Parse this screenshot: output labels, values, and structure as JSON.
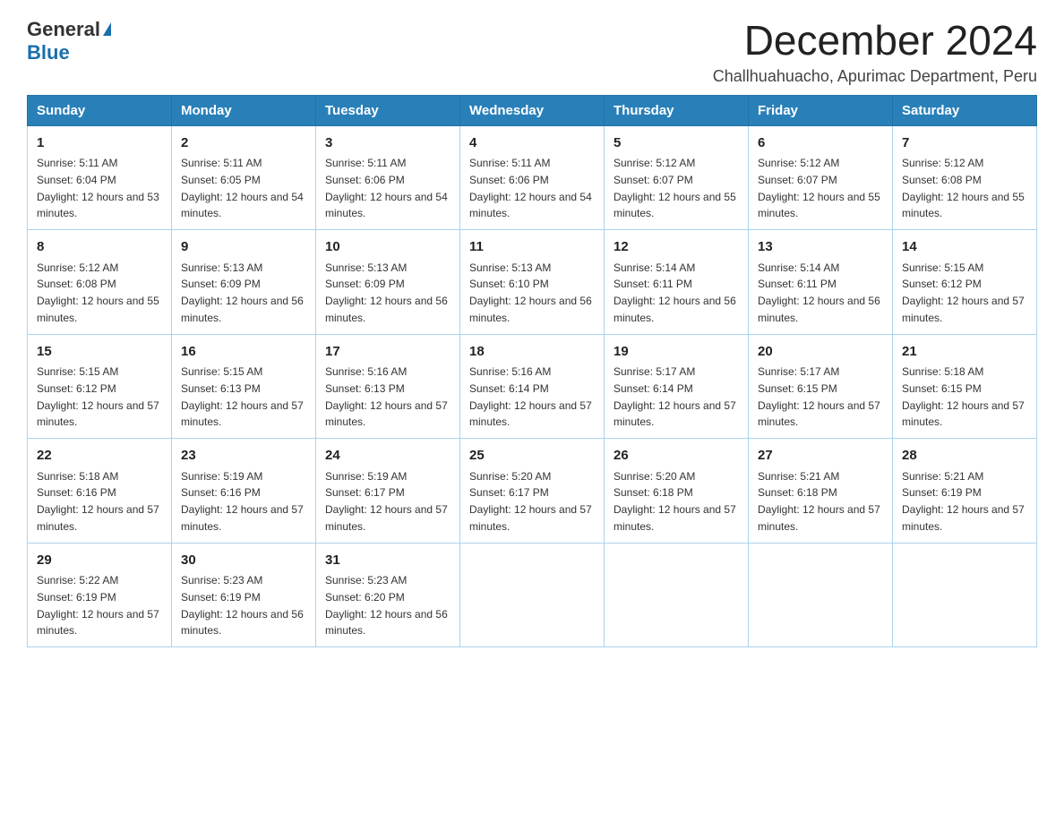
{
  "header": {
    "logo_general": "General",
    "logo_blue": "Blue",
    "month_title": "December 2024",
    "location": "Challhuahuacho, Apurimac Department, Peru"
  },
  "days_of_week": [
    "Sunday",
    "Monday",
    "Tuesday",
    "Wednesday",
    "Thursday",
    "Friday",
    "Saturday"
  ],
  "weeks": [
    [
      {
        "day": "1",
        "sunrise": "5:11 AM",
        "sunset": "6:04 PM",
        "daylight": "12 hours and 53 minutes."
      },
      {
        "day": "2",
        "sunrise": "5:11 AM",
        "sunset": "6:05 PM",
        "daylight": "12 hours and 54 minutes."
      },
      {
        "day": "3",
        "sunrise": "5:11 AM",
        "sunset": "6:06 PM",
        "daylight": "12 hours and 54 minutes."
      },
      {
        "day": "4",
        "sunrise": "5:11 AM",
        "sunset": "6:06 PM",
        "daylight": "12 hours and 54 minutes."
      },
      {
        "day": "5",
        "sunrise": "5:12 AM",
        "sunset": "6:07 PM",
        "daylight": "12 hours and 55 minutes."
      },
      {
        "day": "6",
        "sunrise": "5:12 AM",
        "sunset": "6:07 PM",
        "daylight": "12 hours and 55 minutes."
      },
      {
        "day": "7",
        "sunrise": "5:12 AM",
        "sunset": "6:08 PM",
        "daylight": "12 hours and 55 minutes."
      }
    ],
    [
      {
        "day": "8",
        "sunrise": "5:12 AM",
        "sunset": "6:08 PM",
        "daylight": "12 hours and 55 minutes."
      },
      {
        "day": "9",
        "sunrise": "5:13 AM",
        "sunset": "6:09 PM",
        "daylight": "12 hours and 56 minutes."
      },
      {
        "day": "10",
        "sunrise": "5:13 AM",
        "sunset": "6:09 PM",
        "daylight": "12 hours and 56 minutes."
      },
      {
        "day": "11",
        "sunrise": "5:13 AM",
        "sunset": "6:10 PM",
        "daylight": "12 hours and 56 minutes."
      },
      {
        "day": "12",
        "sunrise": "5:14 AM",
        "sunset": "6:11 PM",
        "daylight": "12 hours and 56 minutes."
      },
      {
        "day": "13",
        "sunrise": "5:14 AM",
        "sunset": "6:11 PM",
        "daylight": "12 hours and 56 minutes."
      },
      {
        "day": "14",
        "sunrise": "5:15 AM",
        "sunset": "6:12 PM",
        "daylight": "12 hours and 57 minutes."
      }
    ],
    [
      {
        "day": "15",
        "sunrise": "5:15 AM",
        "sunset": "6:12 PM",
        "daylight": "12 hours and 57 minutes."
      },
      {
        "day": "16",
        "sunrise": "5:15 AM",
        "sunset": "6:13 PM",
        "daylight": "12 hours and 57 minutes."
      },
      {
        "day": "17",
        "sunrise": "5:16 AM",
        "sunset": "6:13 PM",
        "daylight": "12 hours and 57 minutes."
      },
      {
        "day": "18",
        "sunrise": "5:16 AM",
        "sunset": "6:14 PM",
        "daylight": "12 hours and 57 minutes."
      },
      {
        "day": "19",
        "sunrise": "5:17 AM",
        "sunset": "6:14 PM",
        "daylight": "12 hours and 57 minutes."
      },
      {
        "day": "20",
        "sunrise": "5:17 AM",
        "sunset": "6:15 PM",
        "daylight": "12 hours and 57 minutes."
      },
      {
        "day": "21",
        "sunrise": "5:18 AM",
        "sunset": "6:15 PM",
        "daylight": "12 hours and 57 minutes."
      }
    ],
    [
      {
        "day": "22",
        "sunrise": "5:18 AM",
        "sunset": "6:16 PM",
        "daylight": "12 hours and 57 minutes."
      },
      {
        "day": "23",
        "sunrise": "5:19 AM",
        "sunset": "6:16 PM",
        "daylight": "12 hours and 57 minutes."
      },
      {
        "day": "24",
        "sunrise": "5:19 AM",
        "sunset": "6:17 PM",
        "daylight": "12 hours and 57 minutes."
      },
      {
        "day": "25",
        "sunrise": "5:20 AM",
        "sunset": "6:17 PM",
        "daylight": "12 hours and 57 minutes."
      },
      {
        "day": "26",
        "sunrise": "5:20 AM",
        "sunset": "6:18 PM",
        "daylight": "12 hours and 57 minutes."
      },
      {
        "day": "27",
        "sunrise": "5:21 AM",
        "sunset": "6:18 PM",
        "daylight": "12 hours and 57 minutes."
      },
      {
        "day": "28",
        "sunrise": "5:21 AM",
        "sunset": "6:19 PM",
        "daylight": "12 hours and 57 minutes."
      }
    ],
    [
      {
        "day": "29",
        "sunrise": "5:22 AM",
        "sunset": "6:19 PM",
        "daylight": "12 hours and 57 minutes."
      },
      {
        "day": "30",
        "sunrise": "5:23 AM",
        "sunset": "6:19 PM",
        "daylight": "12 hours and 56 minutes."
      },
      {
        "day": "31",
        "sunrise": "5:23 AM",
        "sunset": "6:20 PM",
        "daylight": "12 hours and 56 minutes."
      },
      null,
      null,
      null,
      null
    ]
  ],
  "colors": {
    "header_bg": "#2980b9",
    "border": "#aad4f0"
  }
}
